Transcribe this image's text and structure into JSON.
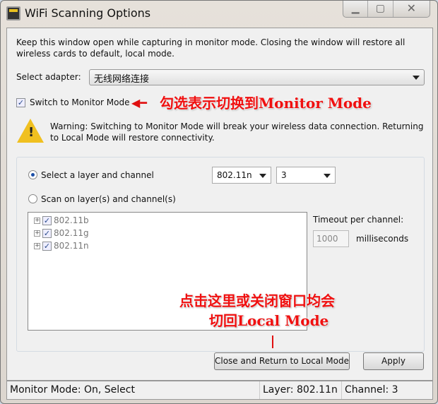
{
  "window": {
    "title": "WiFi Scanning Options",
    "minimize": "▁",
    "maximize": "▢",
    "close": "✕"
  },
  "intro": "Keep this window open while capturing in monitor mode. Closing the window will restore all wireless cards to default, local mode.",
  "adapter": {
    "label": "Select adapter:",
    "value": "无线网络连接"
  },
  "monitor": {
    "label": "Switch to Monitor Mode",
    "checked": true
  },
  "annotation1": "勾选表示切换到Monitor Mode",
  "warning": "Warning: Switching to Monitor Mode will break your wireless data connection. Returning to Local Mode will restore connectivity.",
  "mode": {
    "select_label": "Select a layer and channel",
    "scan_label": "Scan on layer(s) and channel(s)",
    "selected": "select",
    "layer": "802.11n",
    "channel": "3"
  },
  "tree": [
    {
      "label": "802.11b",
      "checked": true
    },
    {
      "label": "802.11g",
      "checked": true
    },
    {
      "label": "802.11n",
      "checked": true
    }
  ],
  "timeout": {
    "label": "Timeout per channel:",
    "value": "1000",
    "unit": "milliseconds"
  },
  "annotation2": [
    "点击这里或关闭窗口均会",
    "切回Local Mode"
  ],
  "buttons": {
    "close_return": "Close and Return to Local Mode",
    "apply": "Apply"
  },
  "status": {
    "mode": "Monitor Mode: On, Select",
    "layer": "Layer: 802.11n",
    "channel": "Channel: 3"
  },
  "colors": {
    "annotation": "#f01010"
  }
}
